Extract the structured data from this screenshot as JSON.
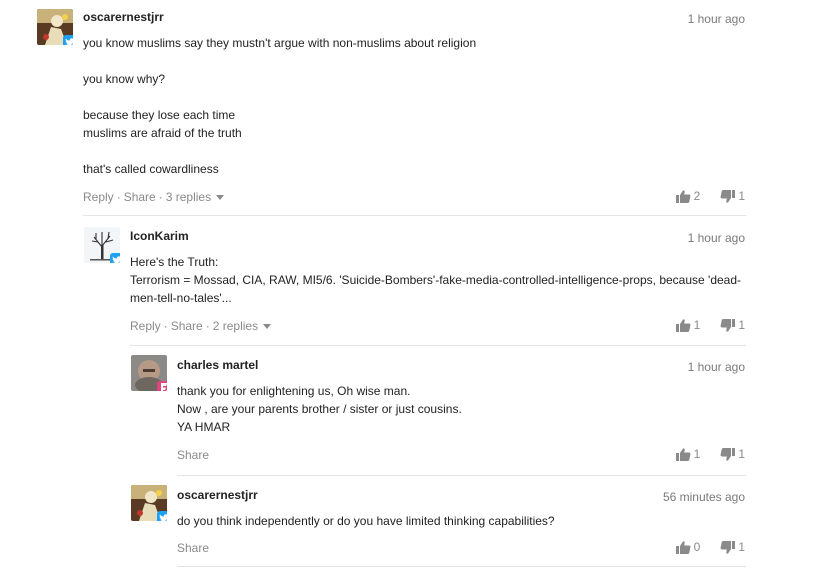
{
  "colors": {
    "twitter": "#1da1f2",
    "other_badge": "#e0457b",
    "muted": "#8a8a8a"
  },
  "comments": [
    {
      "author": "oscarernestjrr",
      "time": "1 hour ago",
      "badge_icon": "twitter-icon",
      "lines": [
        "you know muslims say they mustn't argue with non-muslims about religion",
        "",
        "you know why?",
        "",
        "because they lose each time",
        "muslims are afraid of the truth",
        "",
        "that's called cowardliness"
      ],
      "reply_label": "Reply",
      "share_label": "Share",
      "replies_label": "3 replies",
      "upvotes": "2",
      "downvotes": "1"
    },
    {
      "author": "IconKarim",
      "time": "1 hour ago",
      "badge_icon": "twitter-icon",
      "lines": [
        "Here's the Truth:",
        "Terrorism = Mossad, CIA, RAW, MI5/6. 'Suicide-Bombers'-fake-media-controlled-intelligence-props, because 'dead-",
        "men-tell-no-tales'..."
      ],
      "reply_label": "Reply",
      "share_label": "Share",
      "replies_label": "2 replies",
      "upvotes": "1",
      "downvotes": "1"
    },
    {
      "author": "charles martel",
      "time": "1 hour ago",
      "badge_icon": "foursquare-icon",
      "lines": [
        "thank you for enlightening us, Oh wise man.",
        "Now , are your parents brother / sister or just cousins.",
        "YA HMAR"
      ],
      "share_label": "Share",
      "upvotes": "1",
      "downvotes": "1"
    },
    {
      "author": "oscarernestjrr",
      "time": "56 minutes ago",
      "badge_icon": "twitter-icon",
      "lines": [
        "do you think independently or do you have limited thinking capabilities?"
      ],
      "share_label": "Share",
      "upvotes": "0",
      "downvotes": "1"
    }
  ]
}
